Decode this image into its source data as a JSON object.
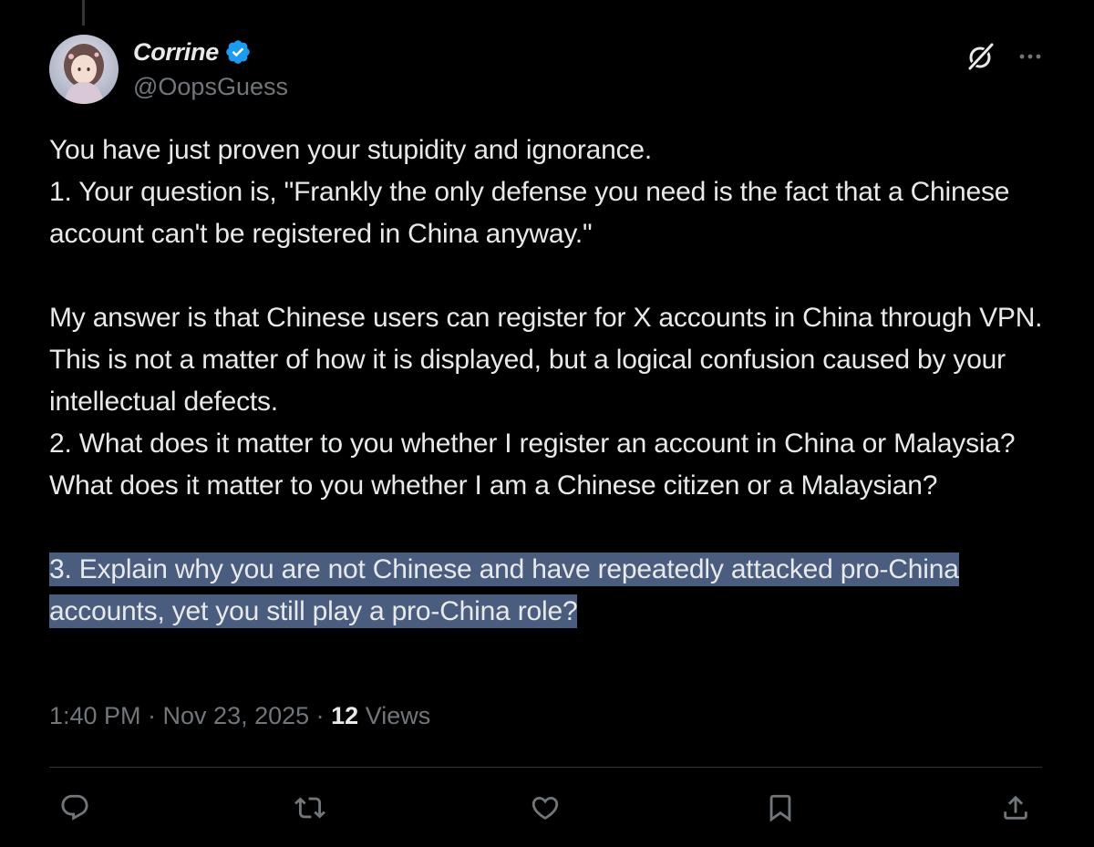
{
  "tweet": {
    "display_name": "Corrine",
    "handle": "@OopsGuess",
    "paragraph_1": "You have just proven your stupidity and ignorance.",
    "paragraph_2": "1. Your question is, \"Frankly the only defense you need is the fact that a Chinese account can't be registered in China anyway.\"",
    "paragraph_3": "My answer is that Chinese users can register for X accounts in China through VPN. This is not a matter of how it is displayed, but a logical confusion caused by your intellectual defects.",
    "paragraph_4": "2. What does it matter to you whether I register an account in China or Malaysia? What does it matter to you whether I am a Chinese citizen or a Malaysian?",
    "paragraph_5_highlighted": "3. Explain why you are not Chinese and have repeatedly attacked pro-China accounts, yet you still play a pro-China role?",
    "timestamp": "1:40 PM · Nov 23, 2025 · ",
    "views_count": "12",
    "views_label": " Views"
  },
  "icons": {
    "verified": "verified-badge-icon",
    "grok": "grok-icon",
    "more": "more-icon",
    "reply": "reply-icon",
    "retweet": "retweet-icon",
    "like": "like-icon",
    "bookmark": "bookmark-icon",
    "share": "share-icon"
  },
  "colors": {
    "background": "#000000",
    "text": "#e7e9ea",
    "secondary": "#71767b",
    "verified": "#1d9bf0",
    "highlight": "#4a5d7e",
    "divider": "#2f3336"
  }
}
